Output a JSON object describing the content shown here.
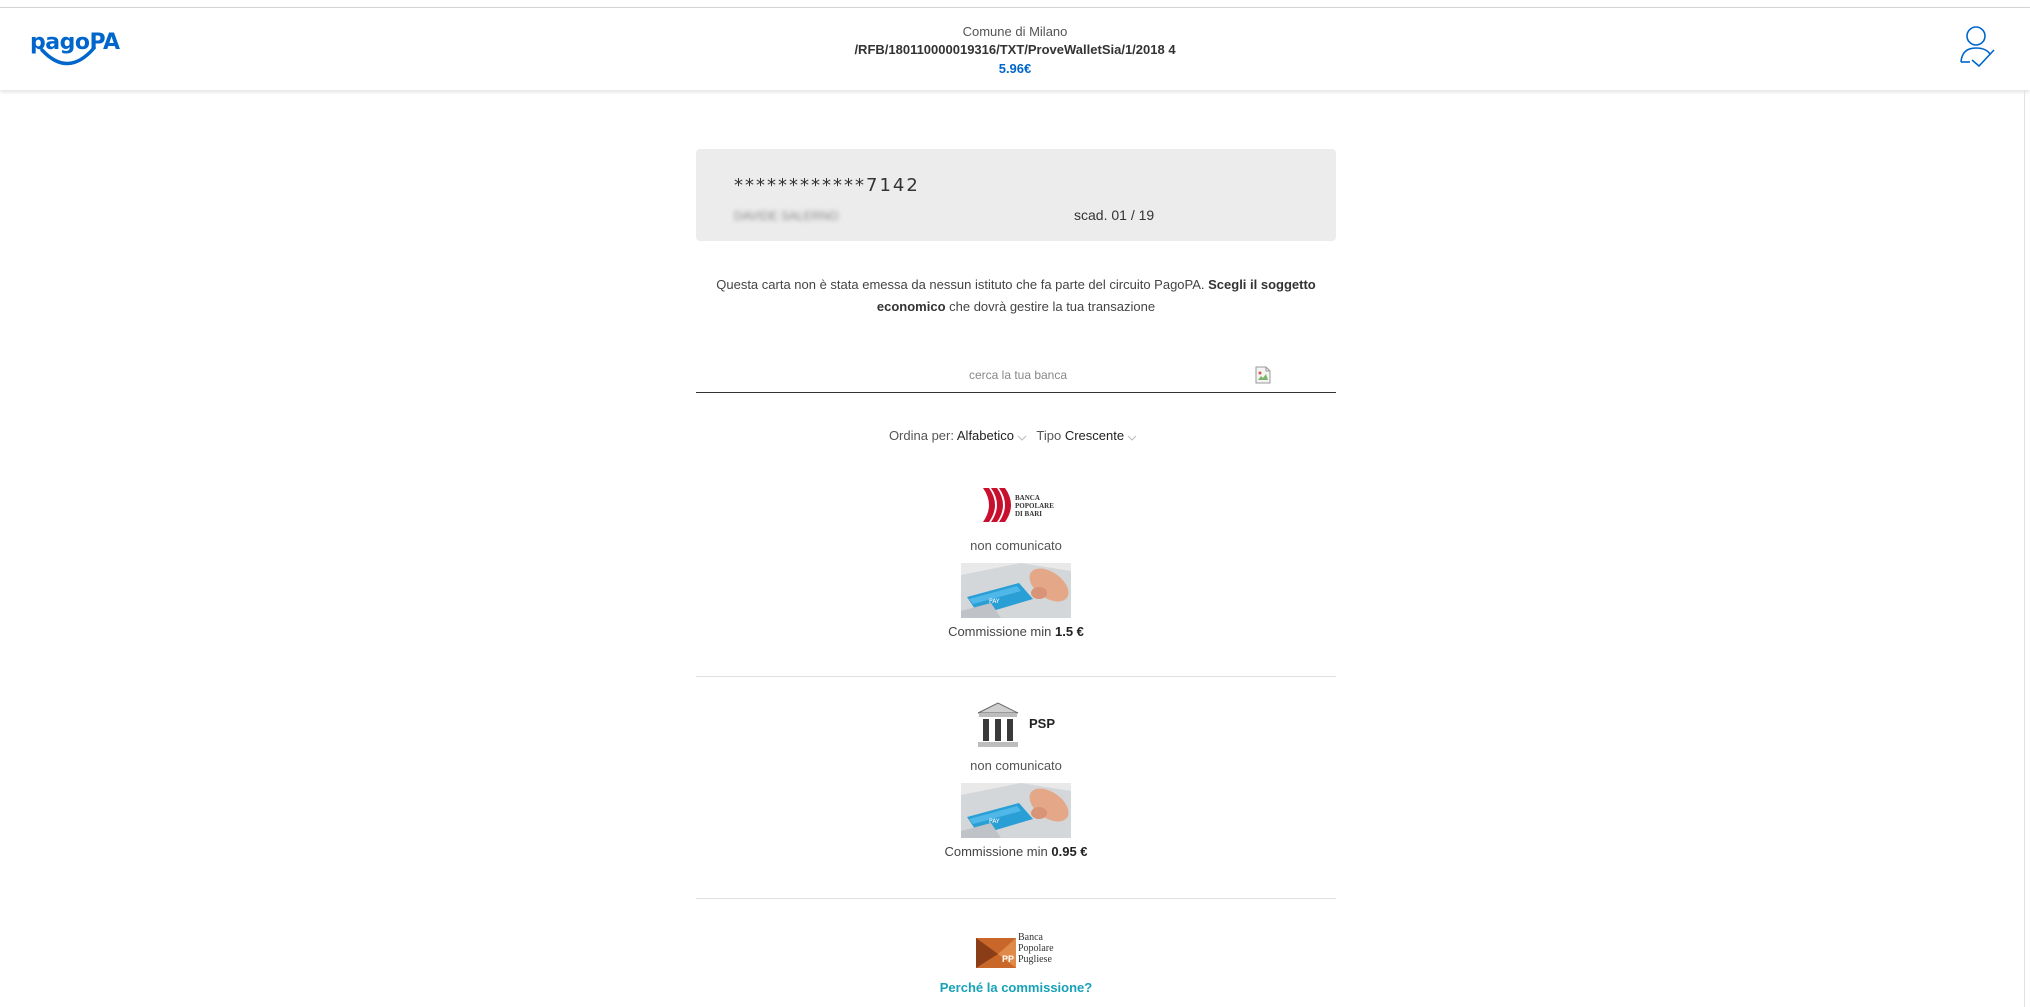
{
  "header": {
    "logo_text": "pagoPA",
    "entity": "Comune di Milano",
    "reference": "/RFB/180110000019316/TXT/ProveWalletSia/1/2018 4",
    "amount": "5.96€"
  },
  "card": {
    "number": "************7142",
    "holder": "DAVIDE SALERNO",
    "expiry": "scad. 01 / 19"
  },
  "info": {
    "text_before": "Questa carta non è stata emessa da nessun istituto che fa parte del circuito PagoPA. ",
    "text_bold": "Scegli il soggetto economico",
    "text_after": " che dovrà gestire la tua transazione"
  },
  "search": {
    "placeholder": "cerca la tua banca"
  },
  "sort": {
    "order_label": "Ordina per:",
    "order_value": "Alfabetico",
    "type_label": "Tipo",
    "type_value": "Crescente"
  },
  "psps": [
    {
      "logo_lines": [
        "BANCA",
        "POPOLARE",
        "DI BARI"
      ],
      "status": "non comunicato",
      "fee_label": "Commissione min",
      "fee_value": "1.5 €"
    },
    {
      "logo_text": "PSP",
      "status": "non comunicato",
      "fee_label": "Commissione min",
      "fee_value": "0.95 €"
    },
    {
      "logo_lines": [
        "Banca",
        "Popolare",
        "Pugliese"
      ],
      "logo_badge": "PP"
    }
  ],
  "footer": {
    "why_link": "Perché la commissione?"
  },
  "colors": {
    "brand_blue": "#0066cc",
    "link_teal": "#17a2b8",
    "card_bg": "#ececec"
  }
}
